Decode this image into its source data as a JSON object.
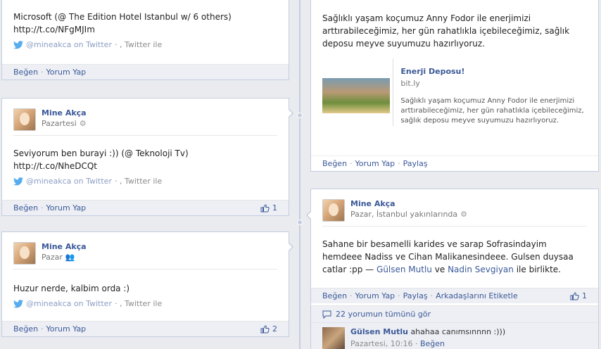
{
  "left_posts": [
    {
      "text": "Microsoft (@ The Edition Hotel Istanbul w/ 6 others)",
      "link": "http://t.co/NFgMJIm",
      "via_handle": "@mineakca on Twitter",
      "via_suffix": "· , Twitter ile",
      "actions": {
        "like": "Beğen",
        "comment": "Yorum Yap"
      }
    },
    {
      "author": "Mine Akça",
      "time": "Pazartesi",
      "text": "Seviyorum ben burayi :)) (@ Teknoloji Tv)",
      "link": "http://t.co/NheDCQt",
      "via_handle": "@mineakca on Twitter",
      "via_suffix": "· , Twitter ile",
      "actions": {
        "like": "Beğen",
        "comment": "Yorum Yap"
      },
      "like_count": "1"
    },
    {
      "author": "Mine Akça",
      "time": "Pazar",
      "text": "Huzur nerde, kalbim orda :)",
      "via_handle": "@mineakca on Twitter",
      "via_suffix": "· , Twitter ile",
      "actions": {
        "like": "Beğen",
        "comment": "Yorum Yap"
      },
      "like_count": "2"
    }
  ],
  "right_posts": [
    {
      "text": "Sağlıklı yaşam koçumuz Anny Fodor ile enerjimizi arttırabileceğimiz, her gün rahatlıkla içebileceğimiz, sağlık deposu meyve suyumuzu hazırlıyoruz.",
      "share": {
        "title": "Enerji Deposu!",
        "domain": "bit.ly",
        "description": "Sağlıklı yaşam koçumuz Anny Fodor ile enerjimizi arttırabileceğimiz, her gün rahatlıkla içebileceğimiz, sağlık deposu meyve suyumuzu hazırlıyoruz."
      },
      "actions": {
        "like": "Beğen",
        "comment": "Yorum Yap",
        "share": "Paylaş"
      }
    },
    {
      "author": "Mine Akça",
      "time": "Pazar, İstanbul yakınlarında",
      "text_main": "Sahane bir besamelli karides ve sarap Sofrasindayim hemdeee Nadiss ve Cihan Malikanesindeee. Gulsen duysaa catlar :pp —",
      "tag1": "Gülsen Mutlu",
      "tag_and": "ve",
      "tag2": "Nadin Sevgiyan",
      "tag_suffix": "ile birlikte.",
      "actions": {
        "like": "Beğen",
        "comment": "Yorum Yap",
        "share": "Paylaş",
        "tag": "Arkadaşlarını Etiketle"
      },
      "like_count": "1",
      "comments_link": "22 yorumun tümünü gör",
      "comment": {
        "author": "Gülsen Mutlu",
        "text": "ahahaa canımsınnnn :)))",
        "time": "Pazartesi, 10:16",
        "like": "Beğen"
      }
    }
  ],
  "colors": {
    "link": "#3b5998",
    "bar": "#edeff4",
    "border": "#c4cde0"
  }
}
